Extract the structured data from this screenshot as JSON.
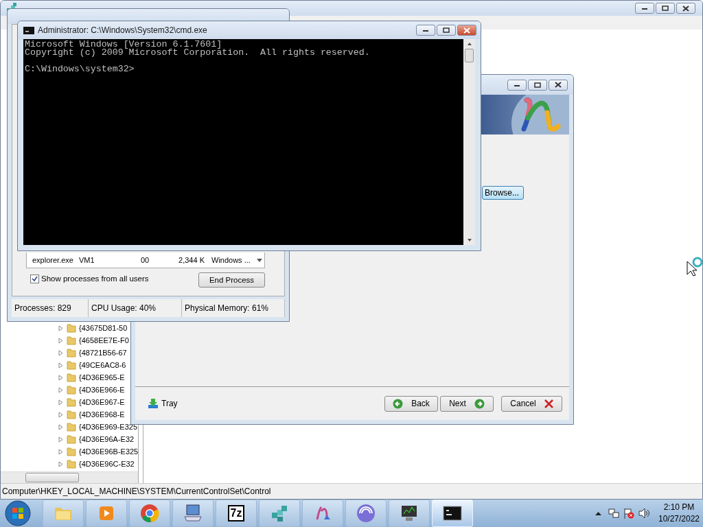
{
  "registry_editor": {
    "tree_items": [
      {
        "label": "{43675D81-50",
        "expanded": false
      },
      {
        "label": "{4658EE7E-F0",
        "expanded": false
      },
      {
        "label": "{48721B56-67",
        "expanded": false
      },
      {
        "label": "{49CE6AC8-6",
        "expanded": false
      },
      {
        "label": "{4D36E965-E",
        "expanded": false
      },
      {
        "label": "{4D36E966-E",
        "expanded": false
      },
      {
        "label": "{4D36E967-E",
        "expanded": false
      },
      {
        "label": "{4D36E968-E",
        "expanded": false
      },
      {
        "label": "{4D36E969-E325",
        "expanded": false
      },
      {
        "label": "{4D36E96A-E32",
        "expanded": false
      },
      {
        "label": "{4D36E96B-E325",
        "expanded": false
      },
      {
        "label": "{4D36E96C-E32",
        "expanded": false
      }
    ],
    "status_bar": "Computer\\HKEY_LOCAL_MACHINE\\SYSTEM\\CurrentControlSet\\Control"
  },
  "wizard": {
    "browse_button": "Browse...",
    "tray_label": "Tray",
    "buttons": [
      {
        "label": "Back",
        "kind": "back"
      },
      {
        "label": "Next",
        "kind": "next"
      },
      {
        "label": "Cancel",
        "kind": "cancel"
      }
    ]
  },
  "task_manager": {
    "process_row": [
      "explorer.exe",
      "VM1",
      "00",
      "2,344 K",
      "Windows ..."
    ],
    "show_all_users": {
      "label": "Show processes from all users",
      "checked": true
    },
    "end_process_button": "End Process",
    "status": [
      "Processes: 829",
      "CPU Usage: 40%",
      "Physical Memory: 61%"
    ]
  },
  "cmd": {
    "title": "Administrator: C:\\Windows\\System32\\cmd.exe",
    "output": [
      "Microsoft Windows [Version 6.1.7601]",
      "Copyright (c) 2009 Microsoft Corporation.  All rights reserved."
    ],
    "prompt": "C:\\Windows\\system32>"
  },
  "taskbar": {
    "apps": [
      {
        "kind": "folder",
        "selected": false
      },
      {
        "kind": "media",
        "selected": false
      },
      {
        "kind": "chrome",
        "selected": false
      },
      {
        "kind": "remote",
        "selected": false
      },
      {
        "kind": "sevenzip",
        "label": "7z",
        "selected": false
      },
      {
        "kind": "registry",
        "selected": false
      },
      {
        "kind": "installer",
        "selected": false
      },
      {
        "kind": "disc",
        "selected": false
      },
      {
        "kind": "monitor",
        "selected": false
      },
      {
        "kind": "console",
        "selected": true
      }
    ],
    "clock": {
      "time": "2:10 PM",
      "date": "10/27/2022"
    }
  }
}
